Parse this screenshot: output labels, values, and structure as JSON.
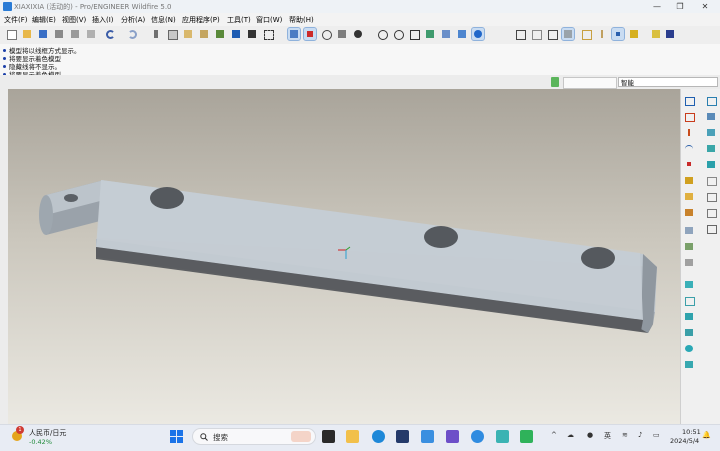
{
  "window": {
    "title": "XIAXIXIA (活动的) - Pro/ENGINEER Wildfire 5.0",
    "minimize_glyph": "—",
    "maximize_glyph": "❐",
    "close_glyph": "✕"
  },
  "menubar": {
    "items": [
      "文件(F)",
      "编辑(E)",
      "视图(V)",
      "插入(I)",
      "分析(A)",
      "信息(N)",
      "应用程序(P)",
      "工具(T)",
      "窗口(W)",
      "帮助(H)"
    ]
  },
  "messages": [
    "模型将以线框方式显示。",
    "将要显示着色模型",
    "隐藏线将不显示。",
    "将要显示着色模型"
  ],
  "filter": {
    "value": "智能"
  },
  "taskbar": {
    "stock_name": "人民币/日元",
    "stock_change": "-0.42%",
    "notification_count": "1",
    "search_placeholder": "搜索",
    "ime": "英",
    "time": "10:51",
    "date": "2024/5/4"
  },
  "colors": {
    "part_top": "#c9d1d8",
    "part_front": "#a9b2ba",
    "part_bottom": "#5d5f62",
    "viewport_top": "#a9a49a",
    "viewport_bottom": "#ebe9e2"
  }
}
